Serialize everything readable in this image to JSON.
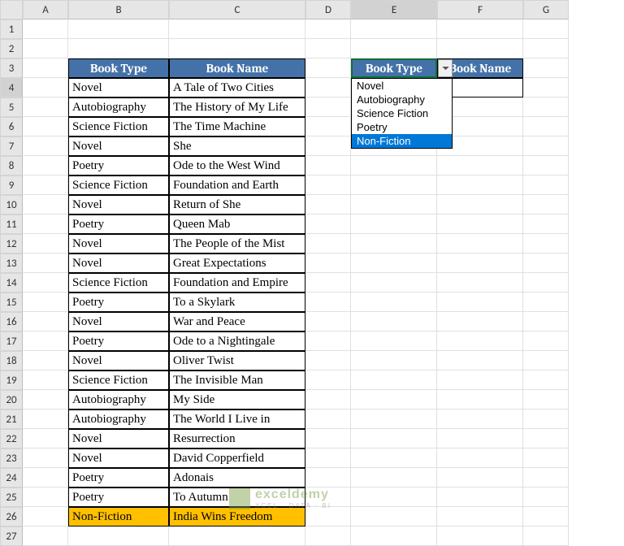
{
  "cols": [
    "A",
    "B",
    "C",
    "D",
    "E",
    "F",
    "G"
  ],
  "rows": [
    1,
    2,
    3,
    4,
    5,
    6,
    7,
    8,
    9,
    10,
    11,
    12,
    13,
    14,
    15,
    16,
    17,
    18,
    19,
    20,
    21,
    22,
    23,
    24,
    25,
    26,
    27
  ],
  "table1": {
    "headers": [
      "Book Type",
      "Book Name"
    ],
    "data": [
      [
        "Novel",
        "A Tale of Two Cities"
      ],
      [
        "Autobiography",
        "The History of My Life"
      ],
      [
        "Science Fiction",
        "The Time Machine"
      ],
      [
        "Novel",
        "She"
      ],
      [
        "Poetry",
        "Ode to the West Wind"
      ],
      [
        "Science Fiction",
        "Foundation and Earth"
      ],
      [
        "Novel",
        "Return of She"
      ],
      [
        "Poetry",
        "Queen Mab"
      ],
      [
        "Novel",
        "The People of the Mist"
      ],
      [
        "Novel",
        "Great Expectations"
      ],
      [
        "Science Fiction",
        "Foundation and Empire"
      ],
      [
        "Poetry",
        "To a Skylark"
      ],
      [
        "Novel",
        "War and Peace"
      ],
      [
        "Poetry",
        "Ode to a Nightingale"
      ],
      [
        "Novel",
        "Oliver Twist"
      ],
      [
        "Science Fiction",
        "The Invisible Man"
      ],
      [
        "Autobiography",
        "My Side"
      ],
      [
        "Autobiography",
        "The World I Live in"
      ],
      [
        "Novel",
        "Resurrection"
      ],
      [
        "Novel",
        "David Copperfield"
      ],
      [
        "Poetry",
        "Adonais"
      ],
      [
        "Poetry",
        "To Autumn"
      ],
      [
        "Non-Fiction",
        "India Wins Freedom"
      ]
    ]
  },
  "table2": {
    "headers": [
      "Book Type",
      "Book Name"
    ],
    "value": "Non-Fiction"
  },
  "dropdown": {
    "options": [
      "Novel",
      "Autobiography",
      "Science Fiction",
      "Poetry",
      "Non-Fiction"
    ],
    "selected": 4
  },
  "watermark": {
    "brand": "exceldemy",
    "tagline": "XCEL · DATA · BI"
  }
}
